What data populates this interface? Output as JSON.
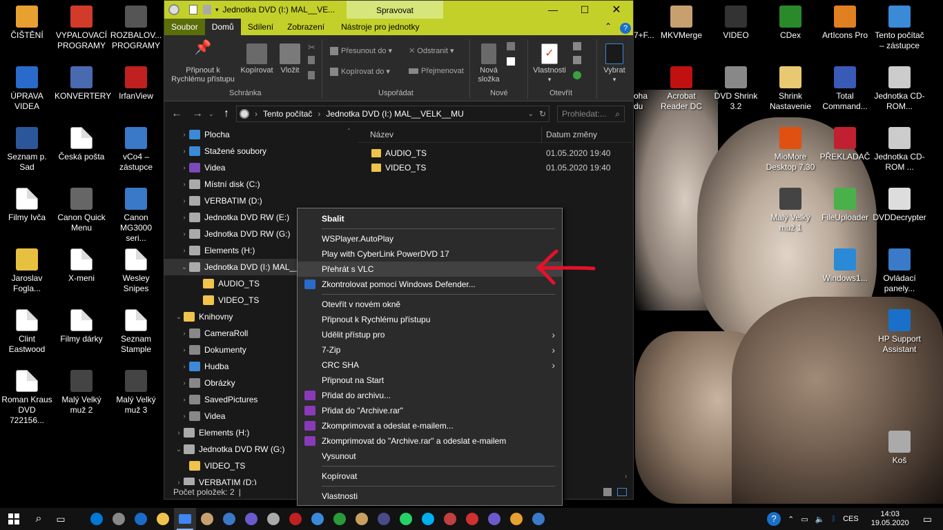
{
  "desktop": {
    "icons_left": [
      {
        "label": "ČIŠTĚNÍ",
        "color": "#e8a030"
      },
      {
        "label": "VYPALOVACÍ PROGRAMY",
        "color": "#d23a2a"
      },
      {
        "label": "ROZBALOV... PROGRAMY",
        "color": "#555"
      },
      {
        "label": "ÚPRAVA VIDEA",
        "color": "#2a6acb"
      },
      {
        "label": "KONVERTERY",
        "color": "#4a6ab0"
      },
      {
        "label": "IrfanView",
        "color": "#c02020"
      },
      {
        "label": "Seznam p. Sad",
        "color": "#2b579a"
      },
      {
        "label": "Česká pošta",
        "color": "#fff"
      },
      {
        "label": "vCo4 – zástupce",
        "color": "#3a78c8"
      },
      {
        "label": "Filmy Ivča",
        "color": "#fff"
      },
      {
        "label": "Canon Quick Menu",
        "color": "#666"
      },
      {
        "label": "Canon MG3000 seri...",
        "color": "#3a78c8"
      },
      {
        "label": "Jaroslav Fogla...",
        "color": "#e8c040"
      },
      {
        "label": "X-meni",
        "color": "#fff"
      },
      {
        "label": "Wesley Snipes",
        "color": "#fff"
      },
      {
        "label": "Clint Eastwood",
        "color": "#fff"
      },
      {
        "label": "Filmy dárky",
        "color": "#fff"
      },
      {
        "label": "Seznam Stample",
        "color": "#fff"
      },
      {
        "label": "Roman Kraus DVD 722156...",
        "color": "#fff"
      },
      {
        "label": "Malý Velký muž 2",
        "color": "#444"
      },
      {
        "label": "Malý Velký muž 3",
        "color": "#444"
      }
    ],
    "icons_right": [
      {
        "label": "MKVMerge",
        "color": "#c8a070"
      },
      {
        "label": "VIDEO",
        "color": "#333"
      },
      {
        "label": "CDex",
        "color": "#2a8a2a"
      },
      {
        "label": "ArtIcons Pro",
        "color": "#e08020"
      },
      {
        "label": "Tento počítač – zástupce",
        "color": "#3a8ad8"
      },
      {
        "label": "Acrobat Reader DC",
        "color": "#c01010"
      },
      {
        "label": "DVD Shrink 3.2",
        "color": "#888"
      },
      {
        "label": "Shrink Nastavenie",
        "color": "#e8c870"
      },
      {
        "label": "Total Command...",
        "color": "#3a5ab8"
      },
      {
        "label": "Jednotka CD-ROM...",
        "color": "#ccc"
      },
      {
        "label": "MioMore Desktop 7.30",
        "color": "#e05010"
      },
      {
        "label": "PŘEKLADAČ",
        "color": "#c02030"
      },
      {
        "label": "Jednotka CD-ROM ...",
        "color": "#ccc"
      },
      {
        "label": "Malý Velký muž 1",
        "color": "#444"
      },
      {
        "label": "FileUploader",
        "color": "#4ab04a"
      },
      {
        "label": "DVDDecrypter",
        "color": "#ddd"
      },
      {
        "label": "Windows1...",
        "color": "#2a8ad8"
      },
      {
        "label": "Ovládací panely...",
        "color": "#3a7ac8"
      },
      {
        "label": "HP Support Assistant",
        "color": "#1a70c8"
      },
      {
        "label": "Koš",
        "color": "#aaa"
      }
    ],
    "partial_labels": [
      "7+F...",
      "oha",
      "du"
    ]
  },
  "explorer": {
    "title": "Jednotka DVD (I:) MAL__VE...",
    "context_tab": "Spravovat",
    "tabs": [
      "Soubor",
      "Domů",
      "Sdílení",
      "Zobrazení",
      "Nástroje pro jednotky"
    ],
    "ribbon": {
      "pin": "Připnout k Rychlému přístupu",
      "copy": "Kopírovat",
      "paste": "Vložit",
      "move_to": "Přesunout do",
      "copy_to": "Kopírovat do",
      "delete": "Odstranit",
      "rename": "Přejmenovat",
      "new_folder": "Nová složka",
      "properties": "Vlastnosti",
      "select": "Vybrat",
      "groups": [
        "Schránka",
        "Uspořádat",
        "Nové",
        "Otevřít"
      ]
    },
    "breadcrumb": [
      "Tento počítač",
      "Jednotka DVD (I:) MAL__VELK__MU"
    ],
    "search_placeholder": "Prohledat:...",
    "nav": [
      {
        "label": "Plocha",
        "color": "#3a8ad8",
        "indent": 0,
        "chev": "›"
      },
      {
        "label": "Stažené soubory",
        "color": "#3a8ad8",
        "indent": 0,
        "chev": "›"
      },
      {
        "label": "Videa",
        "color": "#7a4ab8",
        "indent": 0,
        "chev": "›"
      },
      {
        "label": "Místní disk (C:)",
        "color": "#aaa",
        "indent": 0,
        "chev": "›"
      },
      {
        "label": "VERBATIM (D:)",
        "color": "#aaa",
        "indent": 0,
        "chev": "›"
      },
      {
        "label": "Jednotka DVD RW (E:)",
        "color": "#aaa",
        "indent": 0,
        "chev": "›"
      },
      {
        "label": "Jednotka DVD RW (G:)",
        "color": "#aaa",
        "indent": 0,
        "chev": "›"
      },
      {
        "label": "Elements (H:)",
        "color": "#aaa",
        "indent": 0,
        "chev": "›"
      },
      {
        "label": "Jednotka DVD (I:) MAL__V",
        "color": "#aaa",
        "indent": 0,
        "chev": "⌄"
      },
      {
        "label": "AUDIO_TS",
        "color": "#f0c44c",
        "indent": 1,
        "chev": ""
      },
      {
        "label": "VIDEO_TS",
        "color": "#f0c44c",
        "indent": 1,
        "chev": ""
      },
      {
        "label": "Knihovny",
        "color": "#f0c44c",
        "indent": -1,
        "chev": "⌄"
      },
      {
        "label": "CameraRoll",
        "color": "#888",
        "indent": 0,
        "chev": "›"
      },
      {
        "label": "Dokumenty",
        "color": "#888",
        "indent": 0,
        "chev": "›"
      },
      {
        "label": "Hudba",
        "color": "#3a8ad8",
        "indent": 0,
        "chev": "›"
      },
      {
        "label": "Obrázky",
        "color": "#888",
        "indent": 0,
        "chev": "›"
      },
      {
        "label": "SavedPictures",
        "color": "#888",
        "indent": 0,
        "chev": "›"
      },
      {
        "label": "Videa",
        "color": "#888",
        "indent": 0,
        "chev": "›"
      },
      {
        "label": "Elements (H:)",
        "color": "#aaa",
        "indent": -1,
        "chev": "›"
      },
      {
        "label": "Jednotka DVD RW (G:)",
        "color": "#aaa",
        "indent": -1,
        "chev": "⌄"
      },
      {
        "label": "VIDEO_TS",
        "color": "#f0c44c",
        "indent": 0,
        "chev": ""
      },
      {
        "label": "VERBATIM (D:)",
        "color": "#aaa",
        "indent": -1,
        "chev": "›"
      }
    ],
    "columns": {
      "name": "Název",
      "date": "Datum změny"
    },
    "files": [
      {
        "name": "AUDIO_TS",
        "date": "01.05.2020 19:40"
      },
      {
        "name": "VIDEO_TS",
        "date": "01.05.2020 19:40"
      }
    ],
    "status": "Počet položek: 2"
  },
  "context_menu": [
    {
      "label": "Sbalit",
      "bold": true
    },
    {
      "sep": true
    },
    {
      "label": "WSPlayer.AutoPlay"
    },
    {
      "label": "Play with CyberLink PowerDVD 17"
    },
    {
      "label": "Přehrát s VLC",
      "hl": true
    },
    {
      "label": "Zkontrolovat pomocí Windows Defender...",
      "icon": "#2a6acb"
    },
    {
      "sep": true
    },
    {
      "label": "Otevřít v novém okně"
    },
    {
      "label": "Připnout k Rychlému přístupu"
    },
    {
      "label": "Udělit přístup pro",
      "sub": true
    },
    {
      "label": "7-Zip",
      "sub": true
    },
    {
      "label": "CRC SHA",
      "sub": true
    },
    {
      "label": "Připnout na Start"
    },
    {
      "label": "Přidat do archivu...",
      "icon": "#8a3ab8"
    },
    {
      "label": "Přidat do \"Archive.rar\"",
      "icon": "#8a3ab8"
    },
    {
      "label": "Zkomprimovat a odeslat e-mailem...",
      "icon": "#8a3ab8"
    },
    {
      "label": "Zkomprimovat do \"Archive.rar\" a odeslat e-mailem",
      "icon": "#8a3ab8"
    },
    {
      "label": "Vysunout"
    },
    {
      "sep": true
    },
    {
      "label": "Kopírovat"
    },
    {
      "sep": true
    },
    {
      "label": "Vlastnosti"
    }
  ],
  "taskbar": {
    "apps": [
      "#0078d7",
      "#888",
      "#1a6ac8",
      "#f0c44c",
      "#4285f4",
      "#c8a070",
      "#3a78c8",
      "#6a5acd",
      "#aaa",
      "#c02020",
      "#3a8ad8",
      "#2a9a3a",
      "#c8a060",
      "#4a4a8a",
      "#25d366",
      "#00aff0",
      "#c04040",
      "#d03030",
      "#6a5acd",
      "#e8a030",
      "#3a7ac8"
    ],
    "active_index": 4,
    "lang": "CES",
    "time": "14:03",
    "date": "19.05.2020"
  }
}
